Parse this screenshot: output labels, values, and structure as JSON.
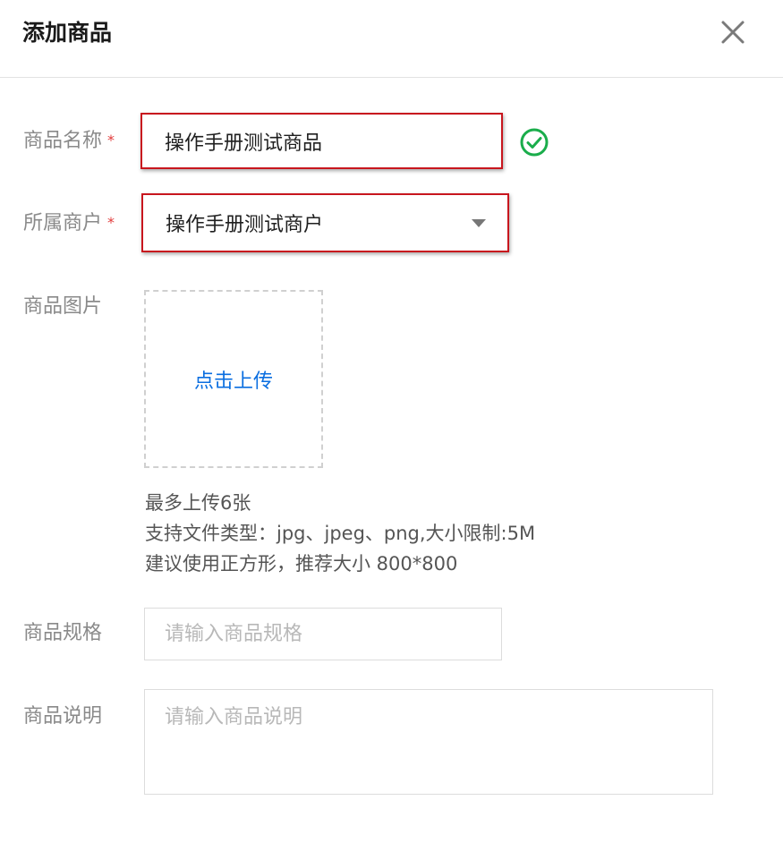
{
  "dialog": {
    "title": "添加商品"
  },
  "form": {
    "name": {
      "label": "商品名称",
      "required_mark": "*",
      "value": "操作手册测试商品"
    },
    "merchant": {
      "label": "所属商户",
      "required_mark": "*",
      "value": "操作手册测试商户"
    },
    "image": {
      "label": "商品图片",
      "upload_label": "点击上传",
      "hints": [
        "最多上传6张",
        "支持文件类型：jpg、jpeg、png,大小限制:5M",
        "建议使用正方形，推荐大小 800*800"
      ]
    },
    "spec": {
      "label": "商品规格",
      "placeholder": "请输入商品规格"
    },
    "description": {
      "label": "商品说明",
      "placeholder": "请输入商品说明"
    }
  },
  "icons": {
    "close": "close-icon",
    "valid": "check-circle-icon",
    "dropdown": "caret-down-icon"
  },
  "colors": {
    "highlight": "#c8161e",
    "link": "#0a6ee0",
    "success": "#1aad4b",
    "required": "#e23b3b"
  }
}
